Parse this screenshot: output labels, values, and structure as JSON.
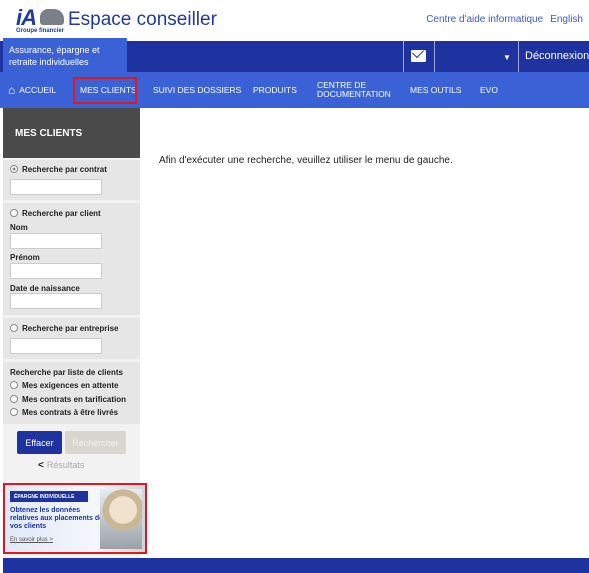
{
  "header": {
    "logo_text": "iA",
    "logo_sub": "Groupe financier",
    "title": "Espace conseiller",
    "links": [
      "Centre d'aide informatique",
      "English"
    ]
  },
  "topbar": {
    "section": "Assurance, épargne et retraite individuelles",
    "logout": "Déconnexion",
    "icons": [
      "mail-icon",
      "caret-down-icon"
    ]
  },
  "nav": {
    "items": [
      "ACCUEIL",
      "MES CLIENTS",
      "SUIVI DES DOSSIERS",
      "PRODUITS",
      "CENTRE DE DOCUMENTATION",
      "MES OUTILS",
      "EVO"
    ],
    "active": "MES CLIENTS"
  },
  "sidebar": {
    "title": "MES CLIENTS",
    "by_contract": {
      "label": "Recherche par contrat",
      "selected": true,
      "value": ""
    },
    "by_client": {
      "label": "Recherche par client",
      "nom": "Nom",
      "prenom": "Prénom",
      "dob": "Date de naissance"
    },
    "by_company": {
      "label": "Recherche par entreprise"
    },
    "by_list": {
      "label": "Recherche par liste de clients",
      "options": [
        "Mes exigences en attente",
        "Mes contrats en tarification",
        "Mes contrats à être livrés"
      ]
    },
    "clear": "Effacer",
    "search": "Rechercher",
    "results": "Résultats"
  },
  "ad": {
    "tag": "ÉPARGNE INDIVIDUELLE",
    "text": "Obtenez les données relatives aux placements de vos clients",
    "link": "En savoir plus >"
  },
  "main": {
    "message": "Afin d'exécuter une recherche, veuillez utiliser le menu de gauche."
  }
}
